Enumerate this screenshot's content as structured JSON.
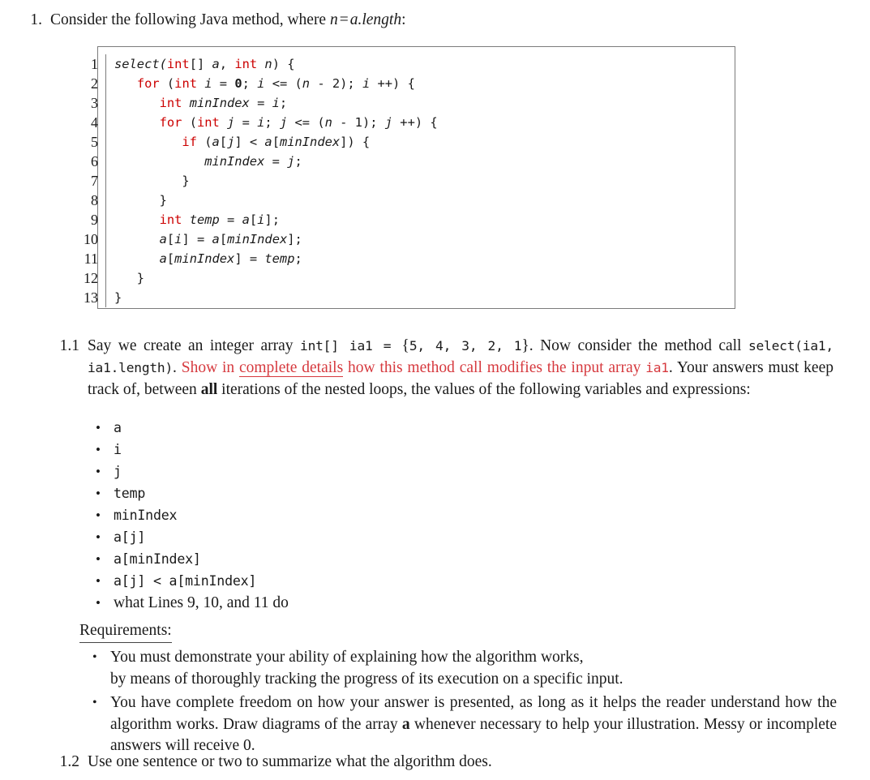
{
  "document": {
    "type": "homework-exercise",
    "colors": {
      "text": "#1a1a1a",
      "code_keyword_red": "#cc0000",
      "emphasis_red": "#d6393e",
      "code_box_border": "#7b7b7b"
    }
  },
  "question1": {
    "number": "1.",
    "text_before": "Consider the following Java method, where ",
    "math_n": "n",
    "math_eq": "=",
    "math_alength": "a.length",
    "text_after": ":"
  },
  "code_listing": {
    "language": "java",
    "line_numbers": [
      "1",
      "2",
      "3",
      "4",
      "5",
      "6",
      "7",
      "8",
      "9",
      "10",
      "11",
      "12",
      "13"
    ],
    "lines": [
      "select(int[] a, int n) {",
      "   for (int i = 0; i <= (n - 2); i ++) {",
      "      int minIndex = i;",
      "      for (int j = i; j <= (n - 1); j ++) {",
      "         if (a[j] < a[minIndex]) {",
      "            minIndex = j;",
      "         }",
      "      }",
      "      int temp = a[i];",
      "      a[i] = a[minIndex];",
      "      a[minIndex] = temp;",
      "   }",
      "}"
    ]
  },
  "question1_1": {
    "number": "1.1",
    "seg1": "Say we create an integer array ",
    "code1": "int[] ia1 = ",
    "brace_open": "{",
    "array_values": "5, 4, 3, 2, 1",
    "brace_close": "}",
    "seg2": ".  Now consider the method call ",
    "code2": "select(ia1, ia1.length)",
    "seg3": ". ",
    "red_seg1": "Show in ",
    "red_underlined": "complete details",
    "red_seg2": " how this method call modifies the input array ",
    "red_code": "ia1",
    "seg4": ". Your answers must keep track of, between ",
    "bold_all": "all",
    "seg5": " iterations of the nested loops, the values of the following variables and expressions:"
  },
  "variable_list": {
    "items": [
      {
        "label": "a",
        "mono": true
      },
      {
        "label": "i",
        "mono": true
      },
      {
        "label": "j",
        "mono": true
      },
      {
        "label": "temp",
        "mono": true
      },
      {
        "label": "minIndex",
        "mono": true
      },
      {
        "label": "a[j]",
        "mono": true
      },
      {
        "label": "a[minIndex]",
        "mono": true
      },
      {
        "label": "a[j] < a[minIndex]",
        "mono": true
      },
      {
        "label": "what Lines 9, 10, and 11 do",
        "mono": false
      }
    ]
  },
  "requirements": {
    "title": "Requirements:",
    "items": [
      {
        "line1": "You must demonstrate your ability of explaining how the algorithm works,",
        "line2": "by means of thoroughly tracking the progress of its execution on a specific input."
      },
      {
        "part1": "You have complete freedom on how your answer is presented, as long as it helps the reader understand how the algorithm works. Draw diagrams of the array ",
        "bold_a": "a",
        "part2": " whenever necessary to help your illustration. Messy or incomplete answers will receive 0."
      }
    ]
  },
  "question1_2": {
    "number": "1.2",
    "text": "Use one sentence or two to summarize what the algorithm does."
  }
}
